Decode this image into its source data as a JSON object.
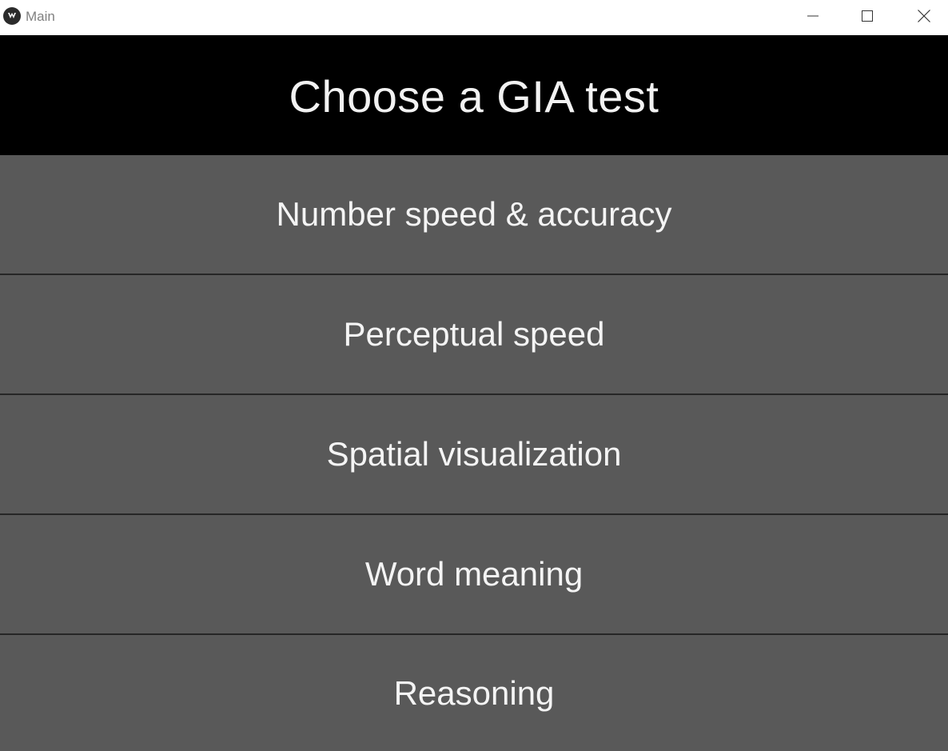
{
  "window": {
    "title": "Main",
    "app_icon": "kivy-icon",
    "controls": {
      "minimize_icon": "minimize-icon",
      "maximize_icon": "maximize-icon",
      "close_icon": "close-icon"
    }
  },
  "header": {
    "title": "Choose a GIA test"
  },
  "tests": [
    {
      "label": "Number speed & accuracy"
    },
    {
      "label": "Perceptual speed"
    },
    {
      "label": "Spatial visualization"
    },
    {
      "label": "Word meaning"
    },
    {
      "label": "Reasoning"
    }
  ],
  "colors": {
    "header_bg": "#000000",
    "button_bg": "#595959",
    "text": "#f4f4f4",
    "divider": "#262626"
  }
}
